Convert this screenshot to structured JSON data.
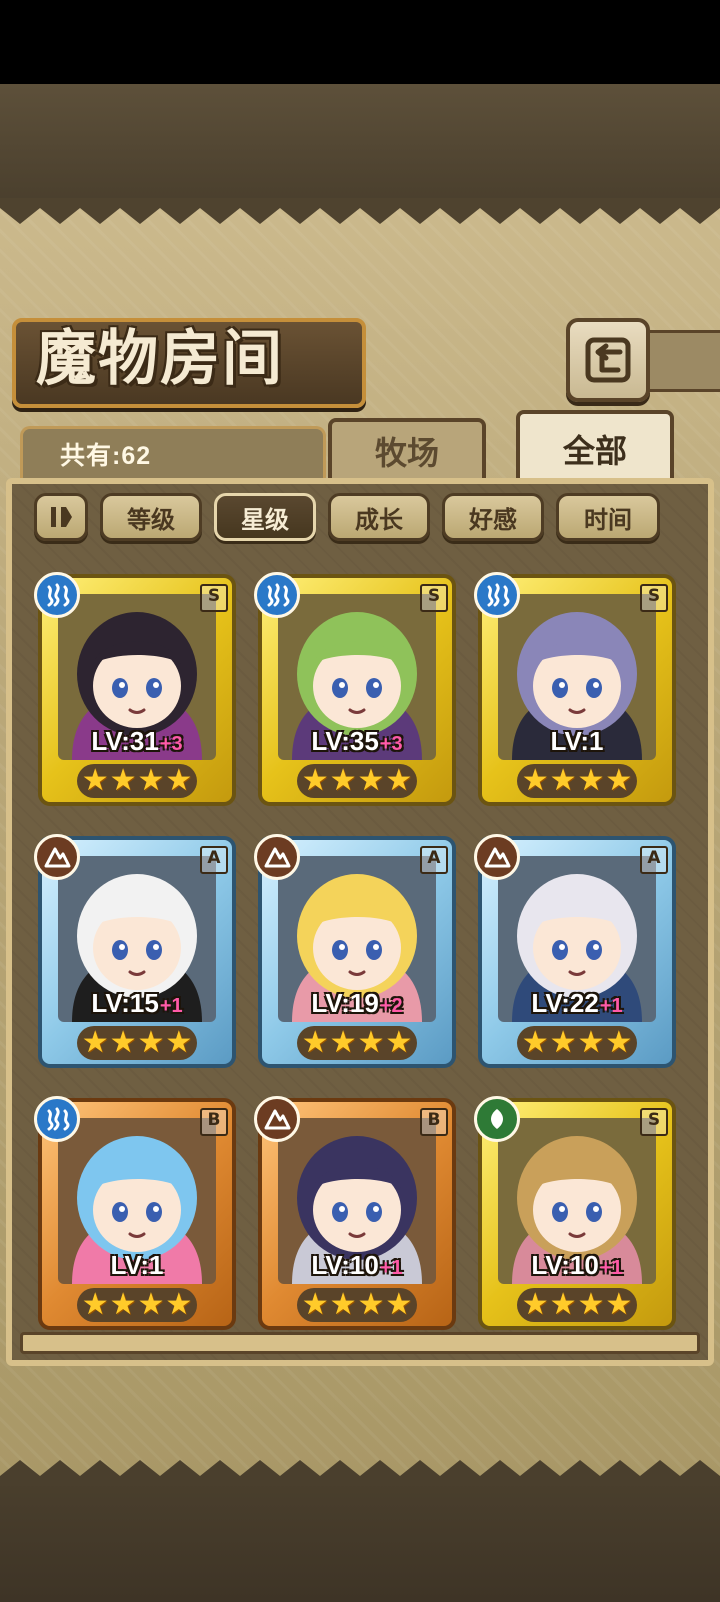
{
  "title": "魔物房间",
  "total_label": "共有:62",
  "tabs": [
    {
      "label": "牧场",
      "selected": false
    },
    {
      "label": "全部",
      "selected": true
    }
  ],
  "sort_buttons": [
    {
      "label": "等级",
      "selected": false
    },
    {
      "label": "星级",
      "selected": true
    },
    {
      "label": "成长",
      "selected": false
    },
    {
      "label": "好感",
      "selected": false
    },
    {
      "label": "时间",
      "selected": false
    }
  ],
  "monsters": [
    {
      "level": "LV:31",
      "plus": "+3",
      "rank": "S",
      "element": "water-icon",
      "stars": 4,
      "hair": "#2d2430",
      "accent": "#8a3a8a"
    },
    {
      "level": "LV:35",
      "plus": "+3",
      "rank": "S",
      "element": "water-icon",
      "stars": 4,
      "hair": "#8fc25a",
      "accent": "#5c3a7a"
    },
    {
      "level": "LV:1",
      "plus": "",
      "rank": "S",
      "element": "water-icon",
      "stars": 4,
      "hair": "#8a86b8",
      "accent": "#2a2a3a"
    },
    {
      "level": "LV:15",
      "plus": "+1",
      "rank": "A",
      "element": "earth-icon",
      "stars": 4,
      "hair": "#f2f2f2",
      "accent": "#1e1e1e"
    },
    {
      "level": "LV:19",
      "plus": "+2",
      "rank": "A",
      "element": "earth-icon",
      "stars": 4,
      "hair": "#f4d35a",
      "accent": "#e89aa8"
    },
    {
      "level": "LV:22",
      "plus": "+1",
      "rank": "A",
      "element": "earth-icon",
      "stars": 4,
      "hair": "#e8e6ee",
      "accent": "#2f4a7a"
    },
    {
      "level": "LV:1",
      "plus": "",
      "rank": "B",
      "element": "water-icon",
      "stars": 4,
      "hair": "#7ec6ef",
      "accent": "#f07aa8"
    },
    {
      "level": "LV:10",
      "plus": "+1",
      "rank": "B",
      "element": "earth-icon",
      "stars": 4,
      "hair": "#3a3460",
      "accent": "#c9c9d6"
    },
    {
      "level": "LV:10",
      "plus": "+1",
      "rank": "S",
      "element": "grass-icon",
      "stars": 4,
      "hair": "#c9a05a",
      "accent": "#d88a9a"
    }
  ]
}
